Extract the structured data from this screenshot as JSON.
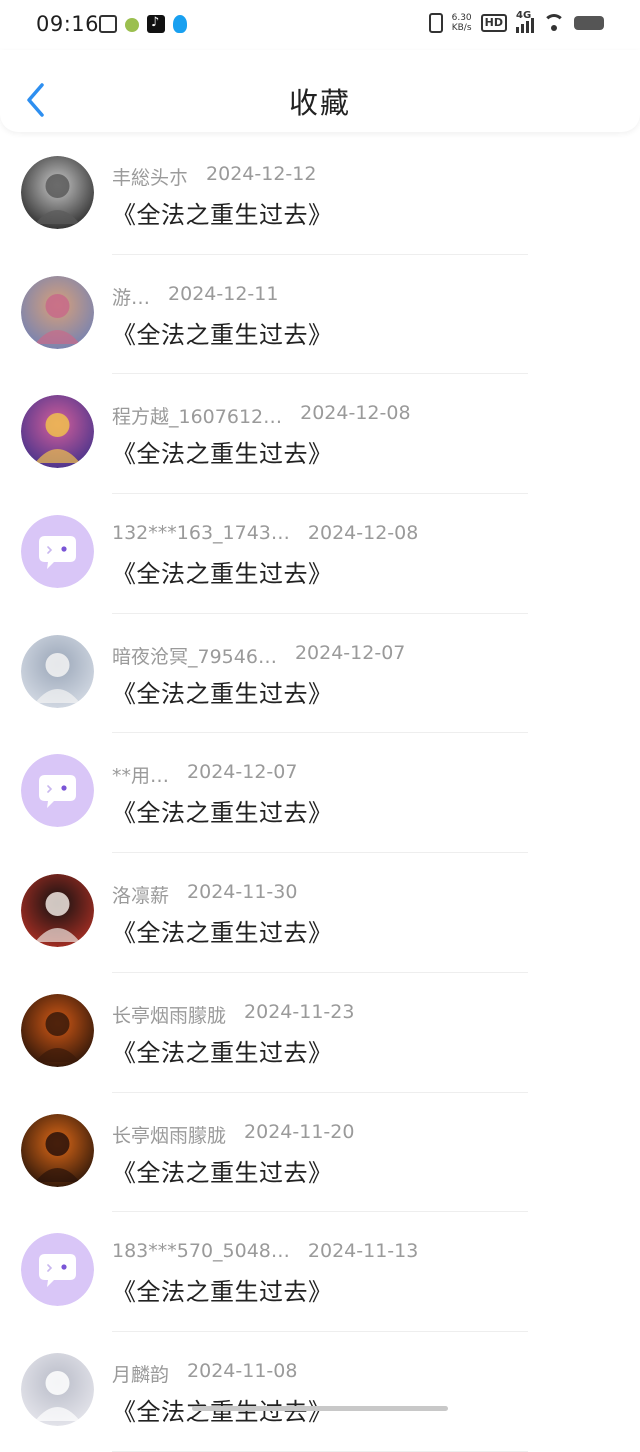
{
  "status_bar": {
    "time": "09:16",
    "net_speed_value": "6.30",
    "net_speed_unit": "KB/s",
    "hd_label": "HD",
    "network_label": "4G"
  },
  "header": {
    "title": "收藏"
  },
  "favorites": [
    {
      "user": "丰総头朩",
      "date": "2024-12-12",
      "title": "《全法之重生过去》",
      "avatar": "photo"
    },
    {
      "user": "游…",
      "date": "2024-12-11",
      "title": "《全法之重生过去》",
      "avatar": "photo"
    },
    {
      "user": "程方越_1607612…",
      "date": "2024-12-08",
      "title": "《全法之重生过去》",
      "avatar": "photo"
    },
    {
      "user": "132***163_1743…",
      "date": "2024-12-08",
      "title": "《全法之重生过去》",
      "avatar": "default"
    },
    {
      "user": "暗夜沧冥_79546…",
      "date": "2024-12-07",
      "title": "《全法之重生过去》",
      "avatar": "photo"
    },
    {
      "user": "**用…",
      "date": "2024-12-07",
      "title": "《全法之重生过去》",
      "avatar": "default"
    },
    {
      "user": "洛凛薪",
      "date": "2024-11-30",
      "title": "《全法之重生过去》",
      "avatar": "photo"
    },
    {
      "user": "长亭烟雨朦胧",
      "date": "2024-11-23",
      "title": "《全法之重生过去》",
      "avatar": "photo"
    },
    {
      "user": "长亭烟雨朦胧",
      "date": "2024-11-20",
      "title": "《全法之重生过去》",
      "avatar": "photo"
    },
    {
      "user": "183***570_5048…",
      "date": "2024-11-13",
      "title": "《全法之重生过去》",
      "avatar": "default"
    },
    {
      "user": "月麟韵",
      "date": "2024-11-08",
      "title": "《全法之重生过去》",
      "avatar": "photo"
    }
  ],
  "colors": {
    "accent": "#2e8ff0",
    "default_avatar_bg": "#d9c6f7",
    "meta_text": "#9a9a9a",
    "title_text": "#222222"
  }
}
